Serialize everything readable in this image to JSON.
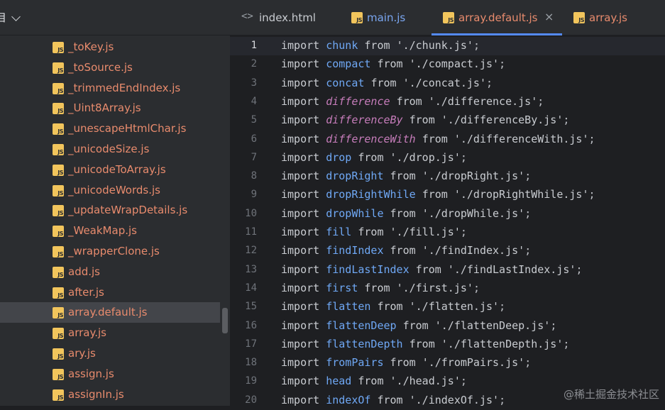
{
  "sidebar": {
    "title": "目",
    "files": [
      {
        "name": "_toKey.js"
      },
      {
        "name": "_toSource.js"
      },
      {
        "name": "_trimmedEndIndex.js"
      },
      {
        "name": "_Uint8Array.js"
      },
      {
        "name": "_unescapeHtmlChar.js"
      },
      {
        "name": "_unicodeSize.js"
      },
      {
        "name": "_unicodeToArray.js"
      },
      {
        "name": "_unicodeWords.js"
      },
      {
        "name": "_updateWrapDetails.js"
      },
      {
        "name": "_WeakMap.js"
      },
      {
        "name": "_wrapperClone.js"
      },
      {
        "name": "add.js"
      },
      {
        "name": "after.js"
      },
      {
        "name": "array.default.js",
        "selected": true
      },
      {
        "name": "array.js"
      },
      {
        "name": "ary.js"
      },
      {
        "name": "assign.js"
      },
      {
        "name": "assignIn.js"
      }
    ],
    "js_badge": "JS"
  },
  "tabs": [
    {
      "label": "index.html",
      "icon": "html-icon"
    },
    {
      "label": "main.js",
      "icon": "js-icon"
    },
    {
      "label": "array.default.js",
      "icon": "js-icon",
      "active": true,
      "close": "×"
    },
    {
      "label": "array.js",
      "icon": "js-icon"
    }
  ],
  "code": {
    "keyword": "import",
    "from_kw": "from",
    "current_line": 1,
    "lines": [
      {
        "n": "1",
        "name": "chunk",
        "path": "'./chunk.js'",
        "italic": false
      },
      {
        "n": "2",
        "name": "compact",
        "path": "'./compact.js'",
        "italic": false
      },
      {
        "n": "3",
        "name": "concat",
        "path": "'./concat.js'",
        "italic": false
      },
      {
        "n": "4",
        "name": "difference",
        "path": "'./difference.js'",
        "italic": true
      },
      {
        "n": "5",
        "name": "differenceBy",
        "path": "'./differenceBy.js'",
        "italic": true
      },
      {
        "n": "6",
        "name": "differenceWith",
        "path": "'./differenceWith.js'",
        "italic": true
      },
      {
        "n": "7",
        "name": "drop",
        "path": "'./drop.js'",
        "italic": false
      },
      {
        "n": "8",
        "name": "dropRight",
        "path": "'./dropRight.js'",
        "italic": false
      },
      {
        "n": "9",
        "name": "dropRightWhile",
        "path": "'./dropRightWhile.js'",
        "italic": false
      },
      {
        "n": "10",
        "name": "dropWhile",
        "path": "'./dropWhile.js'",
        "italic": false
      },
      {
        "n": "11",
        "name": "fill",
        "path": "'./fill.js'",
        "italic": false
      },
      {
        "n": "12",
        "name": "findIndex",
        "path": "'./findIndex.js'",
        "italic": false
      },
      {
        "n": "13",
        "name": "findLastIndex",
        "path": "'./findLastIndex.js'",
        "italic": false
      },
      {
        "n": "14",
        "name": "first",
        "path": "'./first.js'",
        "italic": false
      },
      {
        "n": "15",
        "name": "flatten",
        "path": "'./flatten.js'",
        "italic": false
      },
      {
        "n": "16",
        "name": "flattenDeep",
        "path": "'./flattenDeep.js'",
        "italic": false
      },
      {
        "n": "17",
        "name": "flattenDepth",
        "path": "'./flattenDepth.js'",
        "italic": false
      },
      {
        "n": "18",
        "name": "fromPairs",
        "path": "'./fromPairs.js'",
        "italic": false
      },
      {
        "n": "19",
        "name": "head",
        "path": "'./head.js'",
        "italic": false
      },
      {
        "n": "20",
        "name": "indexOf",
        "path": "'./indexOf.js'",
        "italic": false
      }
    ]
  },
  "watermark": "@稀土掘金技术社区"
}
